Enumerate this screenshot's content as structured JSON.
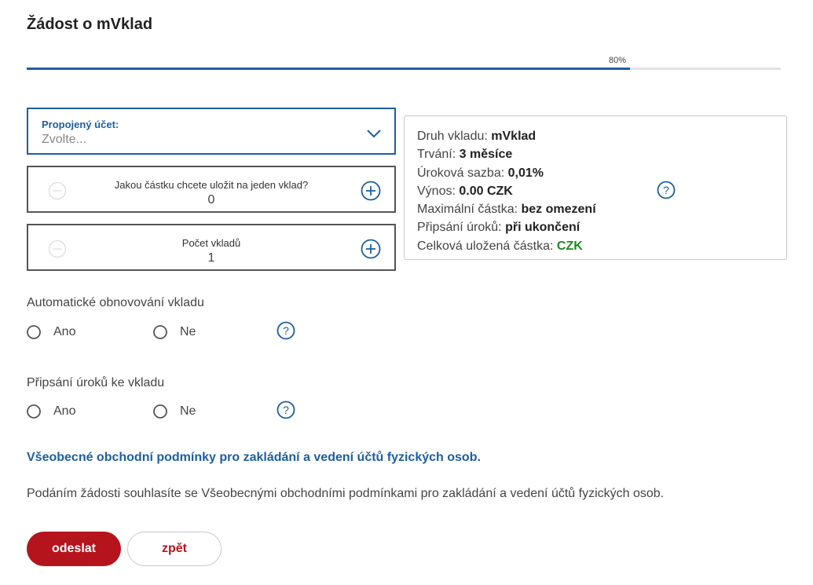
{
  "page": {
    "title": "Žádost o mVklad"
  },
  "progress": {
    "label": "80%",
    "value": 0.8
  },
  "account_select": {
    "label": "Propojený účet:",
    "placeholder": "Zvolte..."
  },
  "amount_stepper": {
    "label": "Jakou částku chcete uložit na jeden vklad?",
    "value": "0"
  },
  "count_stepper": {
    "label": "Počet vkladů",
    "value": "1"
  },
  "summary": {
    "type_label": "Druh vkladu:",
    "type_value": "mVklad",
    "duration_label": "Trvání:",
    "duration_value": "3 měsíce",
    "rate_label": "Úroková sazba:",
    "rate_value": "0,01%",
    "yield_label": "Výnos:",
    "yield_value": "0.00 CZK",
    "max_label": "Maximální částka:",
    "max_value": "bez omezení",
    "interest_label": "Připsání úroků:",
    "interest_value": "při ukončení",
    "total_label": "Celková uložená částka:",
    "total_value": "CZK"
  },
  "auto_renewal": {
    "label": "Automatické obnovování vkladu",
    "yes": "Ano",
    "no": "Ne"
  },
  "interest_credit": {
    "label": "Připsání úroků ke vkladu",
    "yes": "Ano",
    "no": "Ne"
  },
  "terms_link": "Všeobecné obchodní podmínky pro zakládání a vedení účtů fyzických osob.",
  "consent_text": "Podáním žádosti souhlasíte se Všeobecnými obchodními podmínkami pro zakládání a vedení účtů fyzických osob.",
  "buttons": {
    "submit": "odeslat",
    "back": "zpět"
  },
  "colors": {
    "accent_blue": "#1d5fa0",
    "primary_red": "#b5141c",
    "green": "#1e8a1e"
  },
  "icons": {
    "help": "question-circle-icon",
    "plus": "plus-circle-icon",
    "minus": "minus-circle-icon",
    "chevron": "chevron-down-icon"
  }
}
